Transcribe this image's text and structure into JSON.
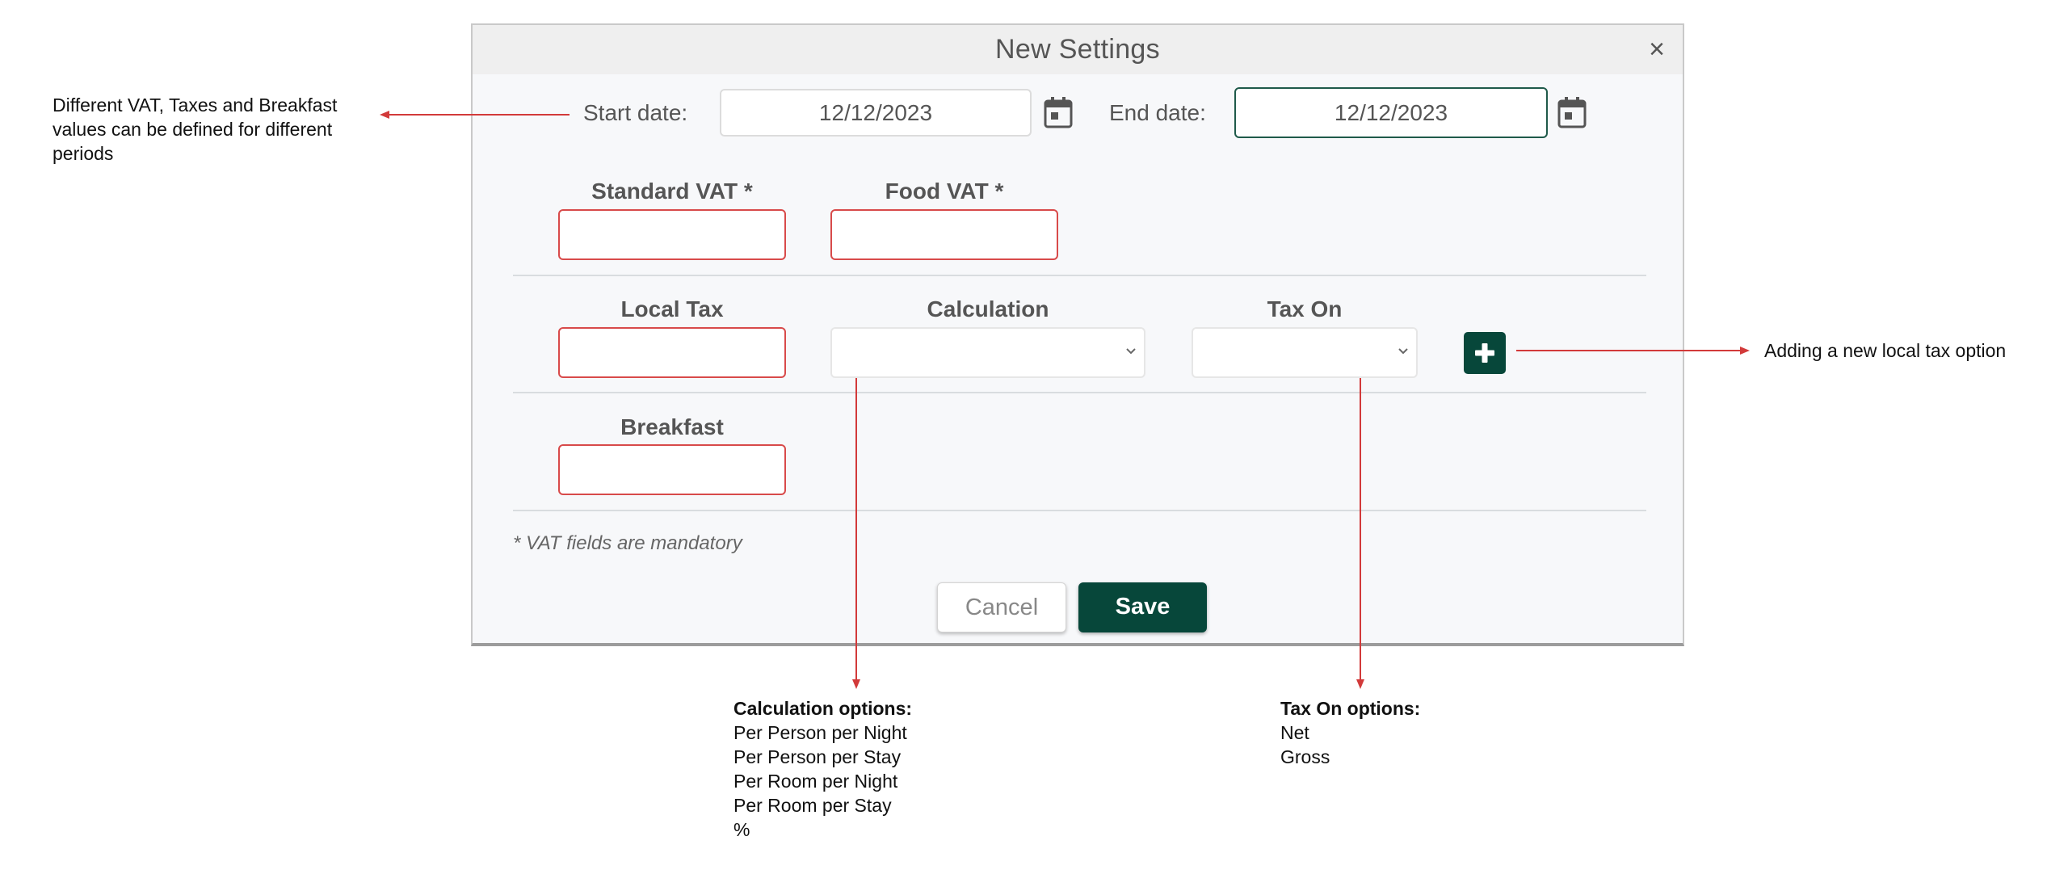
{
  "dialog": {
    "title": "New Settings",
    "close_glyph": "×",
    "start_date_label": "Start date:",
    "start_date_value": "12/12/2023",
    "end_date_label": "End date:",
    "end_date_value": "12/12/2023",
    "standard_vat_label": "Standard VAT  *",
    "food_vat_label": "Food VAT  *",
    "local_tax_label": "Local Tax",
    "calculation_label": "Calculation",
    "tax_on_label": "Tax On",
    "breakfast_label": "Breakfast",
    "mandatory_note": "* VAT fields are mandatory",
    "cancel_label": "Cancel",
    "save_label": "Save",
    "icons": [
      "close-icon",
      "calendar-icon",
      "plus-icon",
      "chevron-down-icon"
    ],
    "colors": {
      "accent": "#07473a",
      "error_border": "#d84a4a",
      "annotation": "#d23a3a"
    }
  },
  "annotations": {
    "periods_note": [
      "Different VAT, Taxes and Breakfast",
      "values can be defined for different",
      "periods"
    ],
    "add_tax_note": "Adding a new local tax option",
    "calculation_title": "Calculation options:",
    "calculation_options": [
      "Per Person per Night",
      "Per Person per Stay",
      "Per Room per Night",
      "Per Room per Stay",
      "%"
    ],
    "tax_on_title": "Tax On options:",
    "tax_on_options": [
      "Net",
      "Gross"
    ]
  }
}
